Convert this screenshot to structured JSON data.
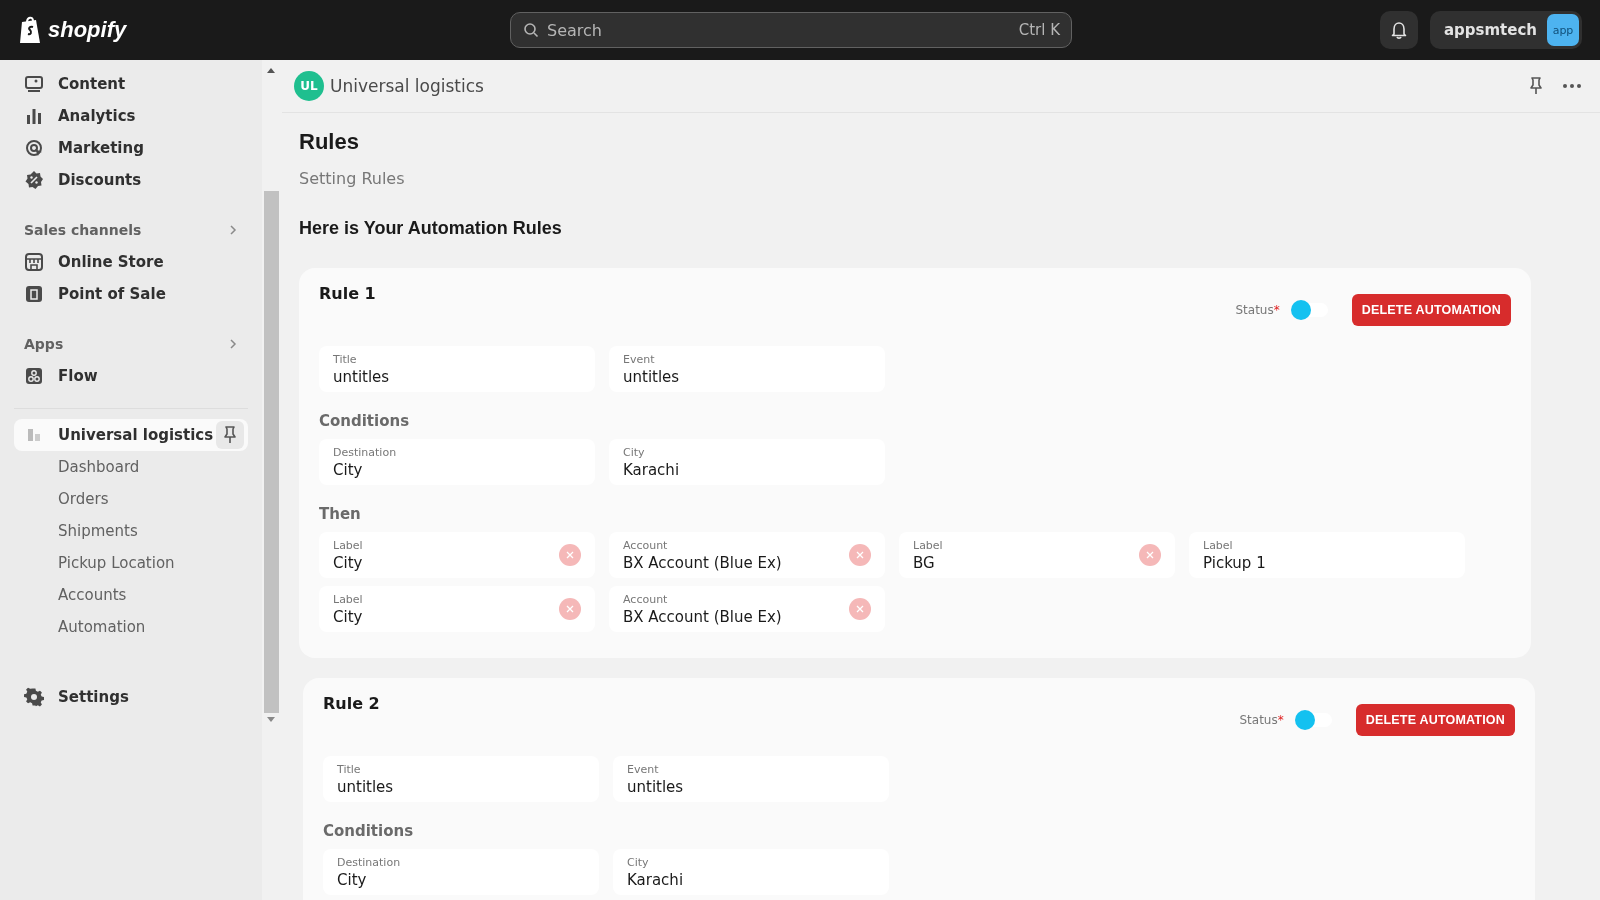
{
  "top_bar": {
    "logo": "shopify",
    "search": {
      "placeholder": "Search",
      "shortcut": "Ctrl K"
    },
    "store": {
      "name": "appsmtech",
      "badge": "app"
    }
  },
  "sidebar": {
    "items": [
      {
        "kind": "item",
        "label": "Content",
        "selected": false
      },
      {
        "kind": "item",
        "label": "Analytics",
        "selected": false
      },
      {
        "kind": "item",
        "label": "Marketing",
        "selected": false
      },
      {
        "kind": "item",
        "label": "Discounts",
        "selected": false
      },
      {
        "kind": "section",
        "label": "Sales channels"
      },
      {
        "kind": "item",
        "label": "Online Store",
        "selected": false
      },
      {
        "kind": "item",
        "label": "Point of Sale",
        "selected": false
      },
      {
        "kind": "section",
        "label": "Apps"
      },
      {
        "kind": "item",
        "label": "Flow",
        "selected": false
      },
      {
        "kind": "app",
        "label": "Universal logistics",
        "selected": true,
        "children": [
          {
            "label": "Dashboard",
            "selected": false
          },
          {
            "label": "Orders",
            "selected": false
          },
          {
            "label": "Shipments",
            "selected": false
          },
          {
            "label": "Pickup Location",
            "selected": false
          },
          {
            "label": "Accounts",
            "selected": false
          },
          {
            "label": "Automation",
            "selected": false
          }
        ]
      },
      {
        "kind": "settings",
        "label": "Settings",
        "selected": false
      }
    ]
  },
  "header": {
    "avatar": "UL",
    "title": "Universal logistics"
  },
  "page": {
    "title": "Rules",
    "subtitle": "Setting Rules",
    "heading": "Here is Your Automation Rules"
  },
  "rules": [
    {
      "name": "Rule 1",
      "status": {
        "label": "Status",
        "required_mark": "*",
        "on": false
      },
      "delete": "DELETE AUTOMATION",
      "fields": [
        {
          "label": "Title",
          "value": "untitles"
        },
        {
          "label": "Event",
          "value": "untitles"
        }
      ],
      "conditions": {
        "title": "Conditions",
        "fields": [
          {
            "label": "Destination",
            "value": "City"
          },
          {
            "label": "City",
            "value": "Karachi"
          }
        ]
      },
      "then": {
        "title": "Then",
        "rows": [
          [
            {
              "label": "Label",
              "value": "City",
              "removable": true
            },
            {
              "label": "Account",
              "value": "BX Account (Blue Ex)",
              "removable": true
            },
            {
              "label": "Label",
              "value": "BG",
              "removable": true
            },
            {
              "label": "Label",
              "value": "Pickup 1",
              "removable": false
            }
          ],
          [
            {
              "label": "Label",
              "value": "City",
              "removable": true
            },
            {
              "label": "Account",
              "value": "BX Account (Blue Ex)",
              "removable": true
            }
          ]
        ]
      }
    },
    {
      "name": "Rule 2",
      "status": {
        "label": "Status",
        "required_mark": "*",
        "on": false
      },
      "delete": "DELETE AUTOMATION",
      "fields": [
        {
          "label": "Title",
          "value": "untitles"
        },
        {
          "label": "Event",
          "value": "untitles"
        }
      ],
      "conditions": {
        "title": "Conditions",
        "fields": [
          {
            "label": "Destination",
            "value": "City"
          },
          {
            "label": "City",
            "value": "Karachi"
          }
        ]
      }
    }
  ]
}
